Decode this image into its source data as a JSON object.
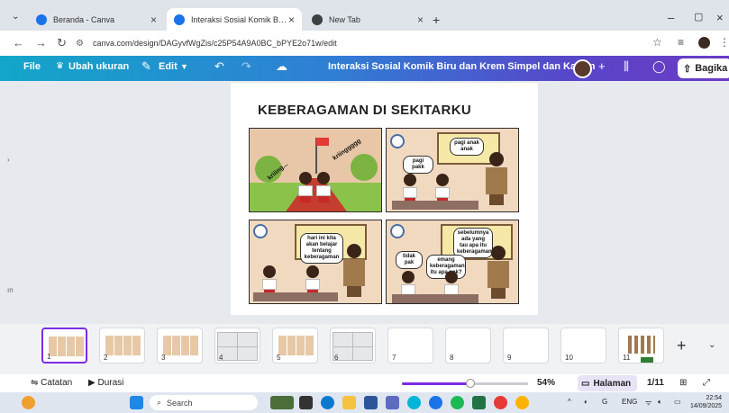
{
  "browser": {
    "tabs": [
      {
        "label": "Beranda - Canva",
        "icon": "canva-icon",
        "active": false
      },
      {
        "label": "Interaksi Sosial Komik Biru dan",
        "icon": "canva-icon",
        "active": true
      },
      {
        "label": "New Tab",
        "icon": "newtab-icon",
        "active": false
      }
    ],
    "url": "canva.com/design/DAGyvfWgZis/c25P54A9A0BC_bPYE2o71w/edit"
  },
  "canva": {
    "menu": {
      "file": "File",
      "resize": "Ubah ukuran",
      "edit": "Edit"
    },
    "doc_title": "Interaksi Sosial Komik Biru dan Krem Simpel dan Kartun",
    "share": "Bagika"
  },
  "page": {
    "title": "KEBERAGAMAN DI SEKITARKU",
    "panel1": {
      "sfx_left": "kriiing...",
      "sfx_right": "kriinggggg"
    },
    "panel2": {
      "bubble_teacher": "pagi anak anak",
      "bubble_kids": "pagi pakk"
    },
    "panel3": {
      "bubble_teacher": "hari ini kita akan belajar tentang keberagaman"
    },
    "panel4": {
      "bubble_teacher": "sebelumnya ada yang tau apa itu keberagaman?",
      "bubble_kid1": "tidak pak",
      "bubble_kid2": "emang keberagaman itu apa pak?"
    }
  },
  "thumbnails": [
    "1",
    "2",
    "3",
    "4",
    "5",
    "6",
    "7",
    "8",
    "9",
    "10",
    "11"
  ],
  "footer": {
    "notes": "Catatan",
    "duration": "Durasi",
    "zoom": "54%",
    "pages_label": "Halaman",
    "page_count": "1/11"
  },
  "taskbar": {
    "search": "Search",
    "lang": "ENG",
    "time": "22:54",
    "date": "14/09/2025"
  },
  "colors": {
    "canva_purple": "#7d2ae8",
    "canva_bar_start": "#13a6c9",
    "canva_bar_end": "#6a3cc4"
  }
}
